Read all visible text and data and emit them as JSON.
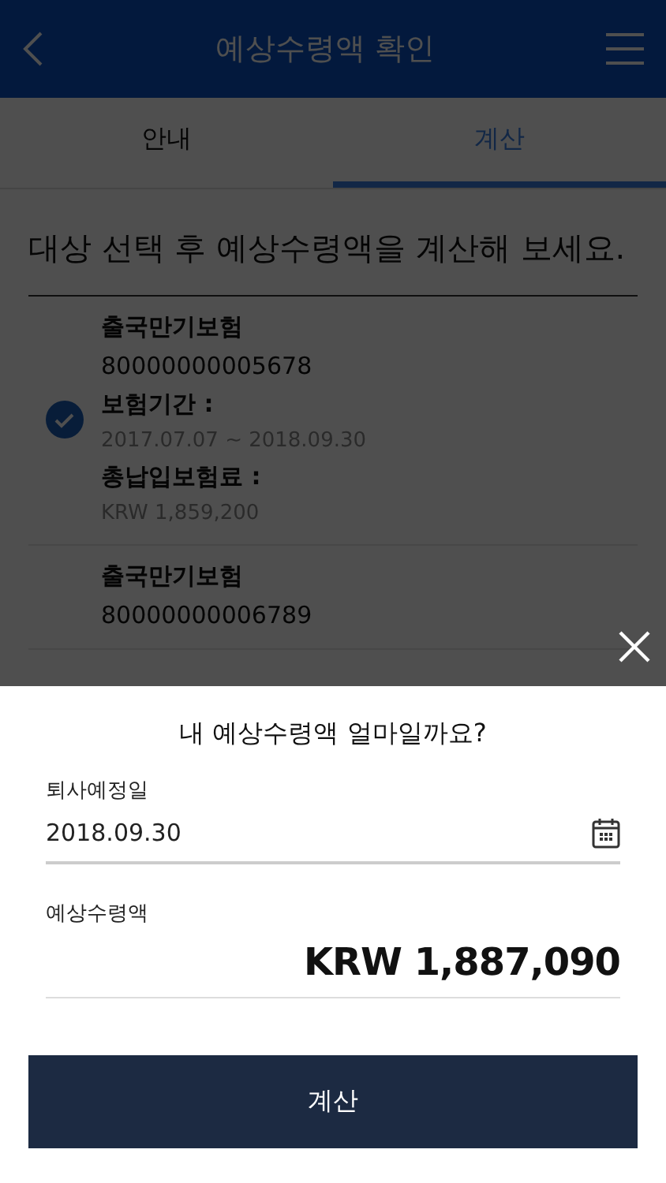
{
  "header": {
    "title": "예상수령액 확인"
  },
  "tabs": [
    {
      "label": "안내",
      "selected": false
    },
    {
      "label": "계산",
      "selected": true
    }
  ],
  "instruction": "대상 선택 후 예상수령액을 계산해 보세요.",
  "policies": [
    {
      "name": "출국만기보험",
      "number": "80000000005678",
      "checked": true,
      "fields": [
        {
          "label": "보험기간 :",
          "value": "2017.07.07 ~ 2018.09.30"
        },
        {
          "label": "총납입보험료 :",
          "value": "KRW 1,859,200"
        }
      ]
    },
    {
      "name": "출국만기보험",
      "number": "80000000006789"
    }
  ],
  "sheet": {
    "title": "내 예상수령액 얼마일까요?",
    "date_label": "퇴사예정일",
    "date_value": "2018.09.30",
    "amount_label": "예상수령액",
    "amount": "KRW 1,887,090",
    "button": "계산"
  }
}
